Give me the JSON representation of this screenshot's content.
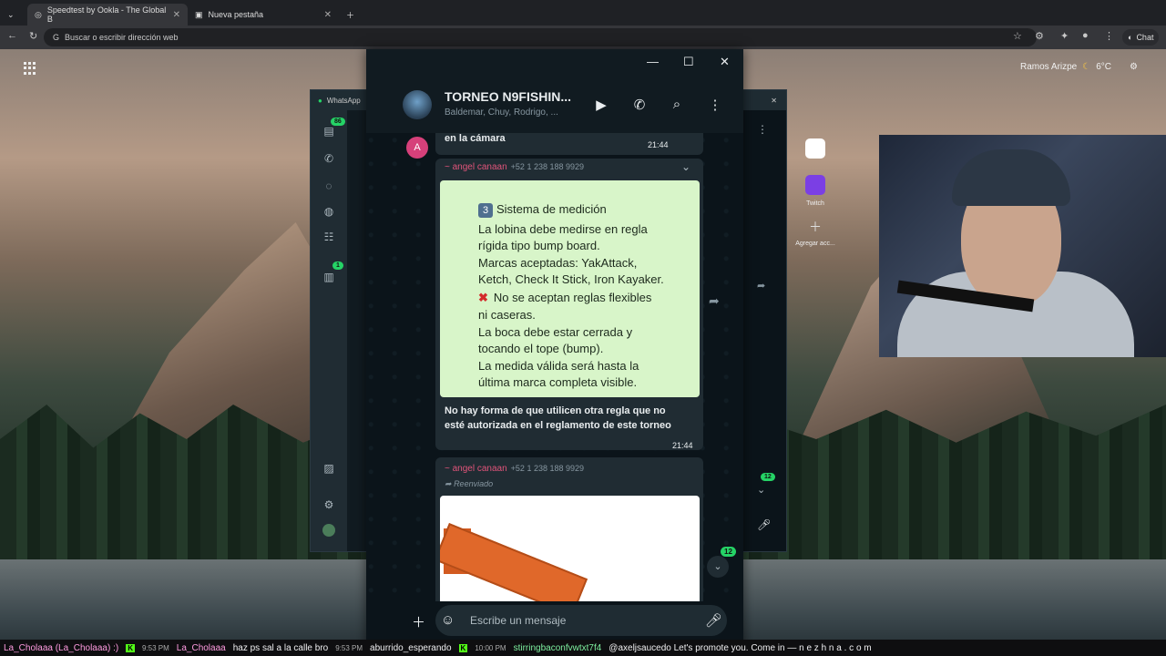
{
  "browser": {
    "tabs": [
      {
        "label": "Speedtest by Ookla - The Global B"
      },
      {
        "label": "Nueva pestaña"
      }
    ],
    "address_placeholder": "Buscar o escribir dirección web",
    "chat_button": "Chat"
  },
  "desktop": {
    "weather_city": "Ramos Arizpe",
    "weather_temp": "6°C"
  },
  "back_window": {
    "title": "WhatsApp",
    "badge_chats": "86",
    "badge_updates": "1",
    "badge_scroll": "12"
  },
  "whatsapp": {
    "chat_title": "TORNEO N9FISHIN...",
    "chat_subtitle": "Baldemar, Chuy, Rodrigo, ...",
    "messages": {
      "m1_text": "en la cámara",
      "m1_time": "21:44",
      "m2_sender": "~ angel canaan",
      "m2_phone": "+52 1 238 188 9929",
      "m2_caption_1": "No hay forma de que utilicen otra regla que no",
      "m2_caption_2": "esté autorizada en el reglamento de este torneo",
      "m2_time": "21:44",
      "m3_sender": "~ angel canaan",
      "m3_phone": "+52 1 238 188 9929",
      "m3_forwarded": "Reenviado"
    },
    "rule_card": {
      "number": "3",
      "lines": [
        "Sistema de medición",
        "La lobina debe medirse en regla",
        "rígida tipo bump board.",
        "Marcas aceptadas: YakAttack,",
        "Ketch, Check It Stick, Iron Kayaker.",
        "No se aceptan reglas flexibles",
        "ni caseras.",
        "La boca debe estar cerrada y",
        "tocando el tope (bump).",
        "La medida válida será hasta la",
        "última marca completa visible."
      ]
    },
    "unread_badge": "12",
    "composer_placeholder": "Escribe un mensaje"
  },
  "extensions": {
    "twitch_label": "Twitch",
    "add_label": "Agregar acc..."
  },
  "ticker": {
    "u1": "La_Cholaaa (La_Cholaaa) :)",
    "t1": "9:53 PM",
    "u2": "La_Cholaaa",
    "m2": "haz ps  sal a la calle bro",
    "t2": "9:53 PM",
    "m3": "aburrido_esperando",
    "t3": "10:00 PM",
    "u4": "stirringbaconfvwtxt7f4",
    "m4": "@axeljsaucedo Let's promote you. Come in — n e z h n a . c o m"
  }
}
